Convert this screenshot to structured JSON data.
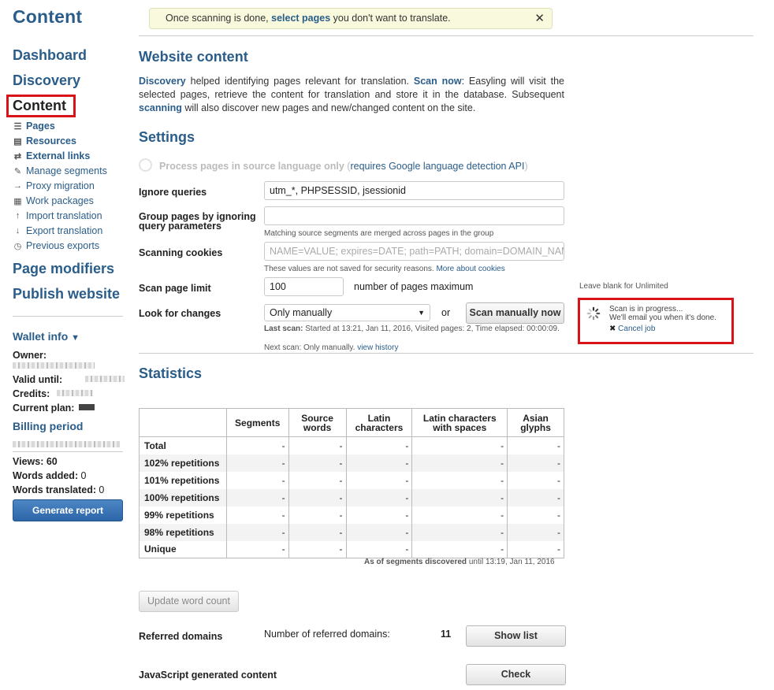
{
  "page_title": "Content",
  "notice": {
    "pre": "Once scanning is done, ",
    "link": "select pages",
    "post": " you don't want to translate."
  },
  "nav": {
    "dashboard": "Dashboard",
    "discovery": "Discovery",
    "content": "Content",
    "sub_items": [
      {
        "label": "Pages",
        "icon": "list-icon",
        "bold": true
      },
      {
        "label": "Resources",
        "icon": "folder-icon",
        "bold": true
      },
      {
        "label": "External links",
        "icon": "link-icon",
        "bold": true
      },
      {
        "label": "Manage segments",
        "icon": "pencil-icon",
        "bold": false
      },
      {
        "label": "Proxy migration",
        "icon": "arrow-right-icon",
        "bold": false
      },
      {
        "label": "Work packages",
        "icon": "package-icon",
        "bold": false
      },
      {
        "label": "Import translation",
        "icon": "arrow-up-icon",
        "bold": false
      },
      {
        "label": "Export translation",
        "icon": "arrow-down-icon",
        "bold": false
      },
      {
        "label": "Previous exports",
        "icon": "clock-icon",
        "bold": false
      }
    ],
    "page_modifiers": "Page modifiers",
    "publish_website": "Publish website"
  },
  "wallet": {
    "title": "Wallet info",
    "owner_label": "Owner:",
    "valid_label": "Valid until:",
    "credits_label": "Credits:",
    "plan_label": "Current plan:",
    "billing_title": "Billing period",
    "views": "Views: 60",
    "words_added_label": "Words added:",
    "words_added": "0",
    "words_translated_label": "Words translated:",
    "words_translated": "0",
    "generate_button": "Generate report"
  },
  "website_content": {
    "title": "Website content",
    "p1": "Discovery",
    "p2": " helped identifying pages relevant for translation. ",
    "p3": "Scan now",
    "p4": ": Easyling will visit the selected pages, retrieve the content for translation and store it in the database. Subsequent ",
    "p5": "scanning",
    "p6": " will also discover new pages and new/changed content on the site."
  },
  "settings": {
    "title": "Settings",
    "process_label": "Process pages in source language only",
    "process_paren_pre": " (",
    "process_link": "requires Google language detection API",
    "process_paren_post": ")",
    "ignore_queries_label": "Ignore queries",
    "ignore_queries_value": "utm_*, PHPSESSID, jsessionid",
    "group_pages_label": "Group pages by ignoring query parameters",
    "group_pages_help": "Matching source segments are merged across pages in the group",
    "scanning_cookies_label": "Scanning cookies",
    "scanning_cookies_placeholder": "NAME=VALUE; expires=DATE; path=PATH; domain=DOMAIN_NAM",
    "cookies_help": "These values are not saved for security reasons. ",
    "cookies_link": "More about cookies",
    "scan_limit_label": "Scan page limit",
    "scan_limit_value": "100",
    "scan_limit_suffix": "number of pages maximum",
    "scan_limit_hint": "Leave blank for Unlimited",
    "look_changes_label": "Look for changes",
    "look_changes_value": "Only manually",
    "or_text": "or",
    "scan_button": "Scan manually now",
    "last_scan_label": "Last scan:",
    "last_scan_text": " Started at 13:21, Jan 11, 2016, Visited pages: 2, Time elapsed: 00:00:09.",
    "next_scan_label": "Next scan:",
    "next_scan_text": " Only manually. ",
    "view_history": "view history",
    "progress_line1": "Scan is in progress...",
    "progress_line2": "We'll email you when it's done.",
    "cancel_job": "Cancel job"
  },
  "statistics": {
    "title": "Statistics",
    "headers": [
      "",
      "Segments",
      "Source words",
      "Latin characters",
      "Latin characters with spaces",
      "Asian glyphs"
    ],
    "rows": [
      {
        "label": "Total",
        "values": [
          "-",
          "-",
          "-",
          "-",
          "-"
        ]
      },
      {
        "label": "102% repetitions",
        "values": [
          "-",
          "-",
          "-",
          "-",
          "-"
        ]
      },
      {
        "label": "101% repetitions",
        "values": [
          "-",
          "-",
          "-",
          "-",
          "-"
        ]
      },
      {
        "label": "100% repetitions",
        "values": [
          "-",
          "-",
          "-",
          "-",
          "-"
        ]
      },
      {
        "label": "99% repetitions",
        "values": [
          "-",
          "-",
          "-",
          "-",
          "-"
        ]
      },
      {
        "label": "98% repetitions",
        "values": [
          "-",
          "-",
          "-",
          "-",
          "-"
        ]
      },
      {
        "label": "Unique",
        "values": [
          "-",
          "-",
          "-",
          "-",
          "-"
        ]
      }
    ],
    "as_of_bold": "As of segments discovered",
    "as_of_rest": " until 13:19, Jan 11, 2016",
    "update_button": "Update word count"
  },
  "referred": {
    "label": "Referred domains",
    "count_label": "Number of referred domains:",
    "count": "11",
    "button": "Show list"
  },
  "javascript": {
    "label": "JavaScript generated content",
    "button": "Check"
  }
}
